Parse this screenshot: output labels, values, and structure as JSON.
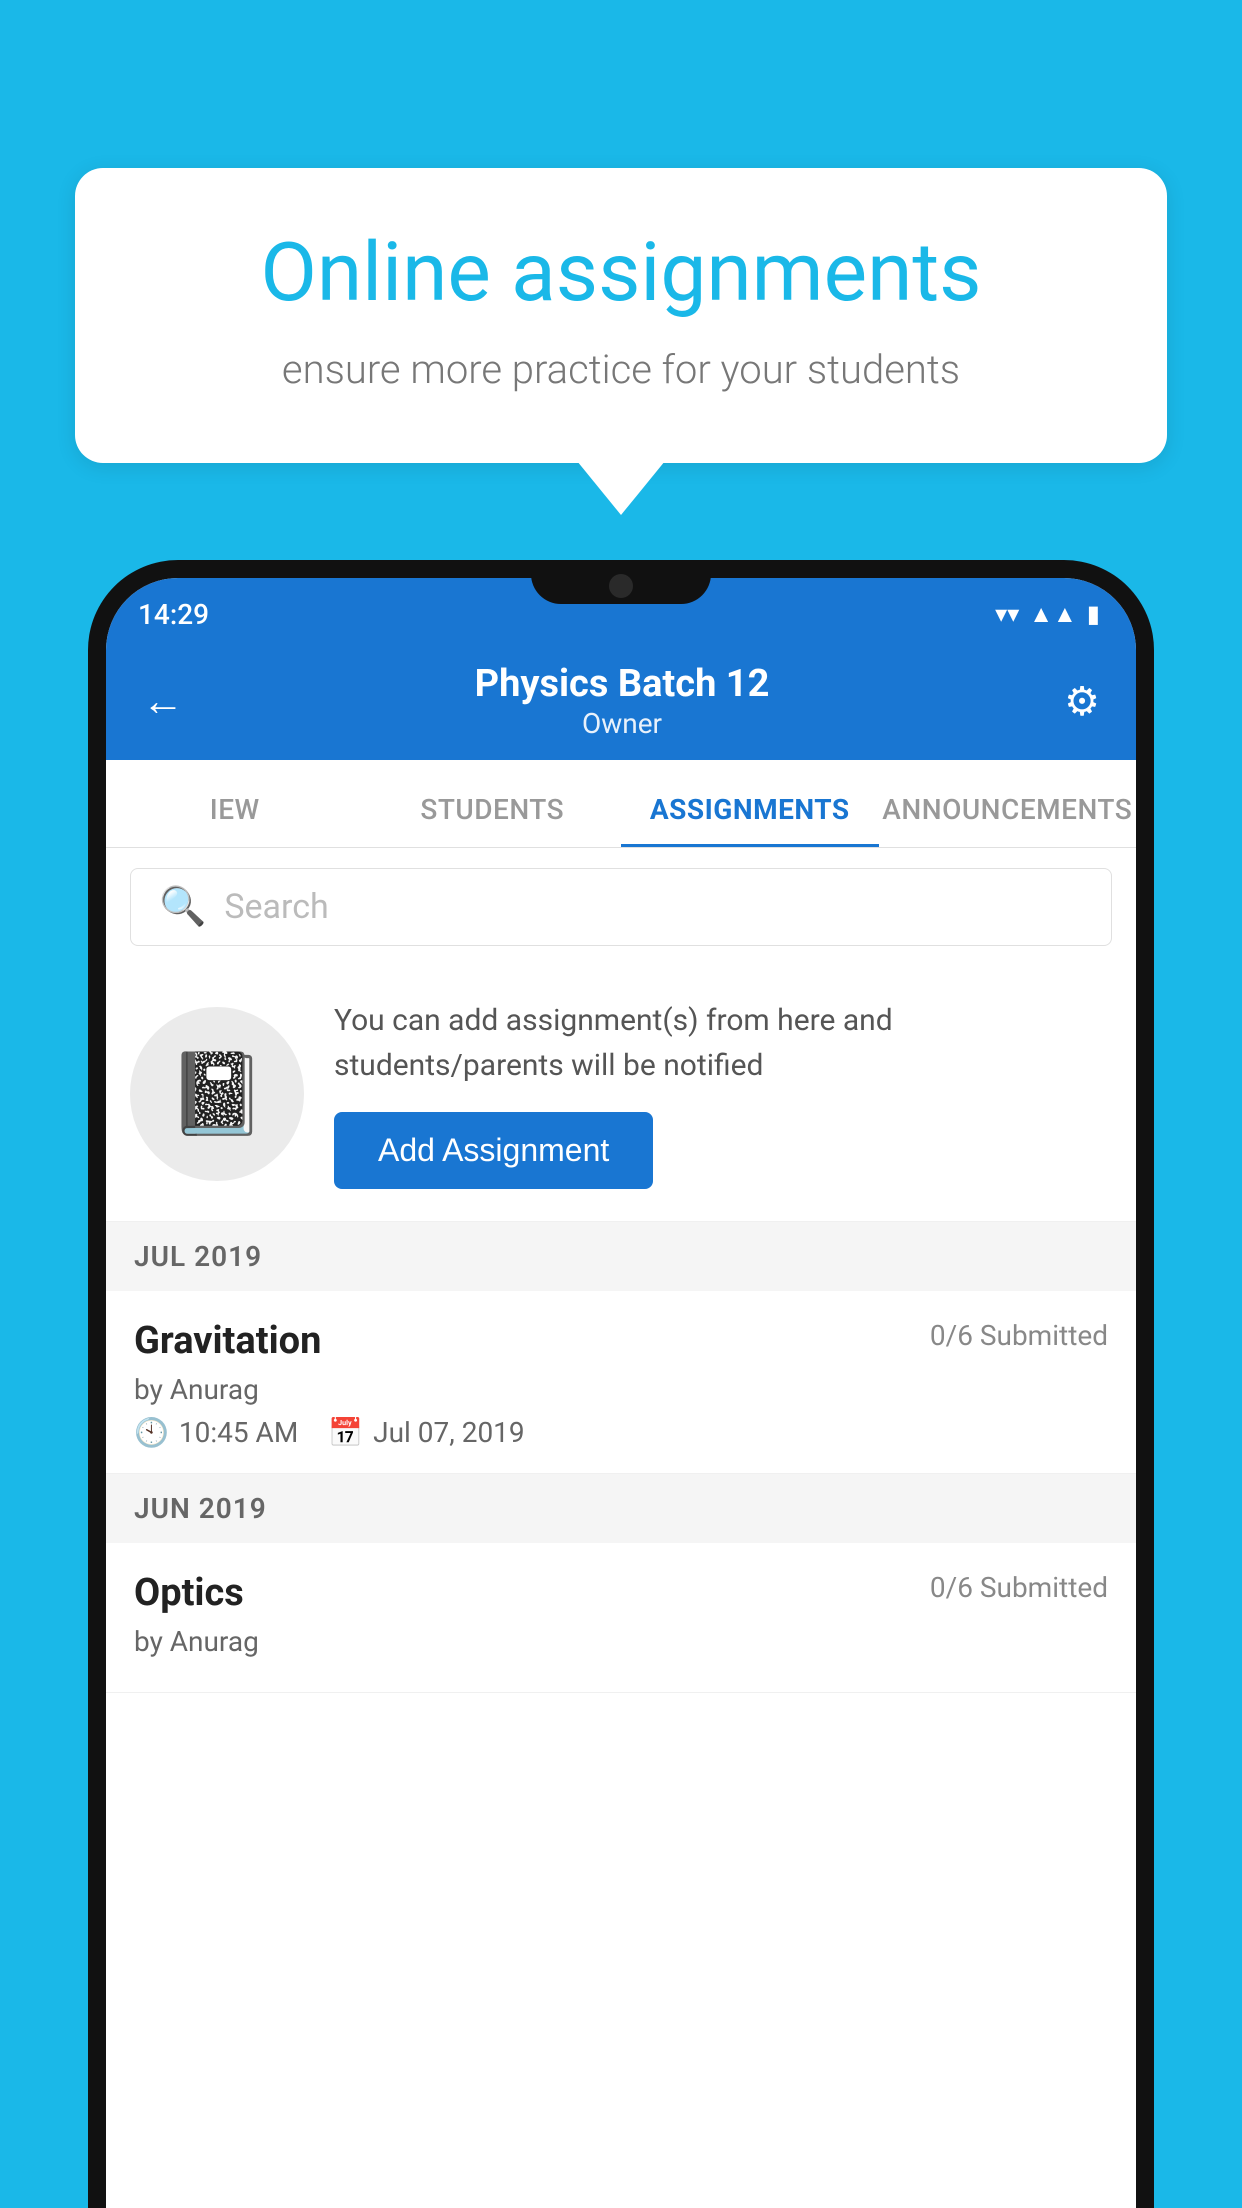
{
  "background_color": "#1ab8e8",
  "speech_bubble": {
    "title": "Online assignments",
    "subtitle": "ensure more practice for your students"
  },
  "phone": {
    "status_bar": {
      "time": "14:29"
    },
    "app_bar": {
      "back_label": "←",
      "title": "Physics Batch 12",
      "subtitle": "Owner",
      "settings_label": "⚙"
    },
    "tabs": [
      {
        "label": "IEW",
        "active": false
      },
      {
        "label": "STUDENTS",
        "active": false
      },
      {
        "label": "ASSIGNMENTS",
        "active": true
      },
      {
        "label": "ANNOUNCEMENTS",
        "active": false
      }
    ],
    "search": {
      "placeholder": "Search"
    },
    "promo": {
      "text": "You can add assignment(s) from here and students/parents will be notified",
      "button_label": "Add Assignment"
    },
    "sections": [
      {
        "label": "JUL 2019",
        "assignments": [
          {
            "name": "Gravitation",
            "submitted": "0/6 Submitted",
            "author": "by Anurag",
            "time": "10:45 AM",
            "date": "Jul 07, 2019"
          }
        ]
      },
      {
        "label": "JUN 2019",
        "assignments": [
          {
            "name": "Optics",
            "submitted": "0/6 Submitted",
            "author": "by Anurag",
            "time": "",
            "date": ""
          }
        ]
      }
    ]
  }
}
